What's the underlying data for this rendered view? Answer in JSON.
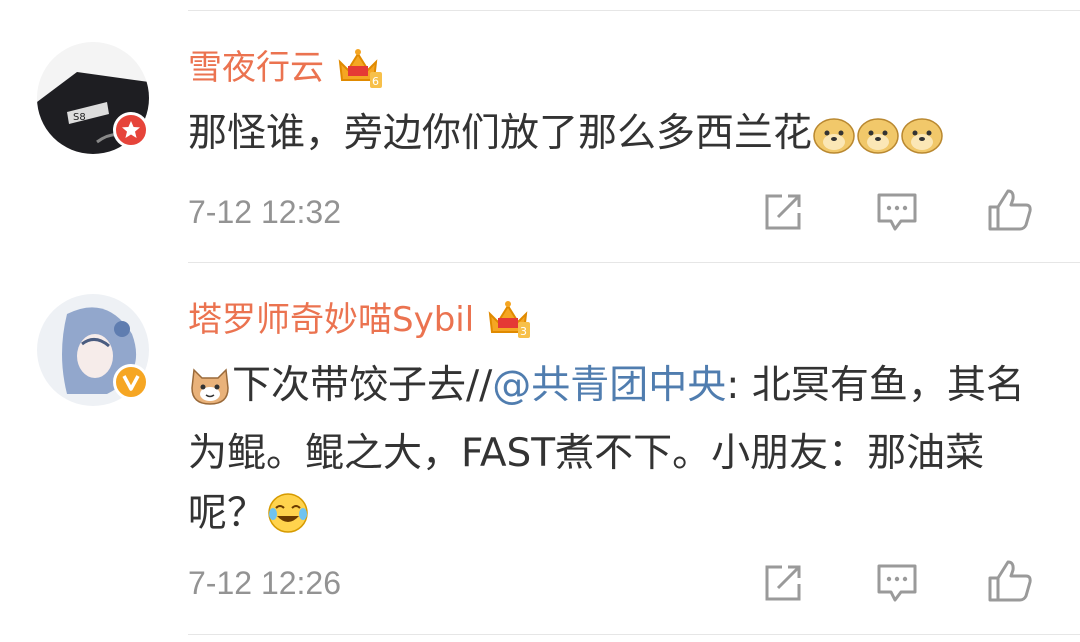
{
  "comments": [
    {
      "username": "雪夜行云",
      "text": "那怪谁，旁边你们放了那么多西兰花",
      "emoji_count": 3,
      "time": "7-12 12:32"
    },
    {
      "username": "塔罗师奇妙喵Sybil",
      "text_before": "下次带饺子去//",
      "mention": "@共青团中央",
      "text_after": ": 北冥有鱼，其名为鲲。鲲之大，FAST煮不下。小朋友：那油菜呢？",
      "time": "7-12 12:26"
    }
  ],
  "icons": {
    "share": "share-icon",
    "comment": "comment-icon",
    "like": "like-icon"
  },
  "colors": {
    "username": "#eb7350",
    "mention": "#507daf",
    "text": "#333333",
    "time": "#939393",
    "icon": "#9a9a9a"
  }
}
